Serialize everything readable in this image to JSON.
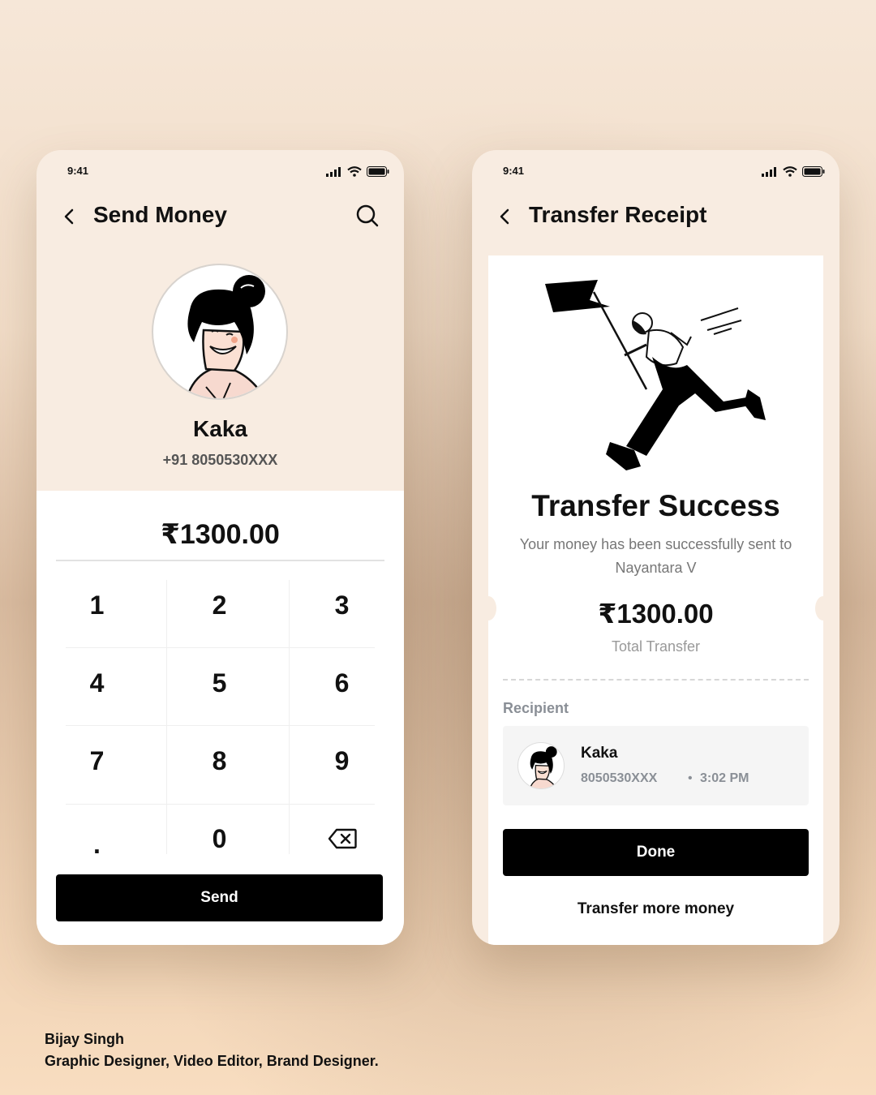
{
  "send_screen": {
    "time": "9:41",
    "title": "Send Money",
    "contact_name": "Kaka",
    "contact_phone": "+91 8050530XXX",
    "amount": "₹1300.00",
    "keys": [
      "1",
      "2",
      "3",
      "4",
      "5",
      "6",
      "7",
      "8",
      "9",
      ".",
      "0"
    ],
    "send_label": "Send"
  },
  "receipt_screen": {
    "time": "9:41",
    "title": "Transfer Receipt",
    "success_title": "Transfer Success",
    "success_line1": "Your money has been successfully sent to",
    "success_line2": "Nayantara V",
    "amount": "₹1300.00",
    "amount_label": "Total Transfer",
    "recipient_label": "Recipient",
    "recipient_name": "Kaka",
    "recipient_phone": "8050530XXX",
    "recipient_time": "3:02 PM",
    "done_label": "Done",
    "more_label": "Transfer more money"
  },
  "credit": {
    "name": "Bijay Singh",
    "role": "Graphic Designer, Video Editor, Brand Designer."
  }
}
